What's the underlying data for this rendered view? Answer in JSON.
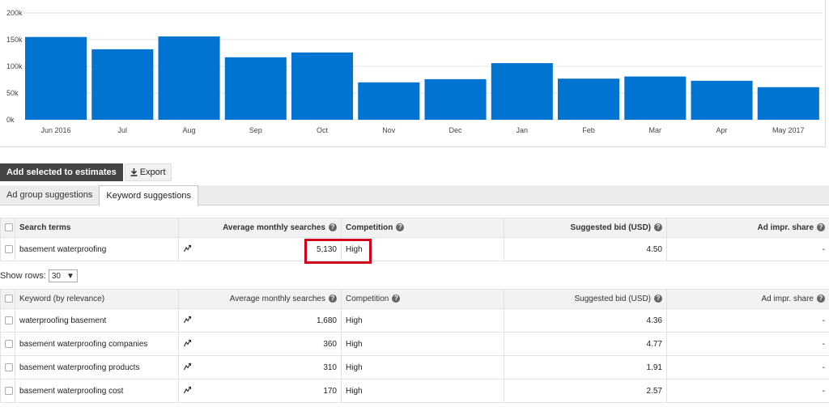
{
  "chart_data": {
    "type": "bar",
    "categories": [
      "Jun 2016",
      "Jul",
      "Aug",
      "Sep",
      "Oct",
      "Nov",
      "Dec",
      "Jan",
      "Feb",
      "Mar",
      "Apr",
      "May 2017"
    ],
    "values": [
      155000,
      132000,
      156000,
      117000,
      126000,
      70000,
      76000,
      106000,
      77000,
      81000,
      73000,
      61000
    ],
    "ylim": [
      0,
      200000
    ],
    "yticks": [
      "0k",
      "50k",
      "100k",
      "150k",
      "200k"
    ],
    "grid": true,
    "bar_color": "#0074d0"
  },
  "toolbar": {
    "add_label": "Add selected to estimates",
    "export_label": "Export"
  },
  "tabs": [
    {
      "label": "Ad group suggestions",
      "active": false
    },
    {
      "label": "Keyword suggestions",
      "active": true
    }
  ],
  "search_table": {
    "headers": {
      "term": "Search terms",
      "avg": "Average monthly searches",
      "competition": "Competition",
      "bid": "Suggested bid (USD)",
      "share": "Ad impr. share"
    },
    "rows": [
      {
        "term": "basement waterproofing",
        "avg": "5,130",
        "competition": "High",
        "bid": "4.50",
        "share": "-"
      }
    ]
  },
  "show_rows": {
    "label": "Show rows:",
    "value": "30"
  },
  "keyword_table": {
    "headers": {
      "term": "Keyword (by relevance)",
      "avg": "Average monthly searches",
      "competition": "Competition",
      "bid": "Suggested bid (USD)",
      "share": "Ad impr. share"
    },
    "rows": [
      {
        "term": "waterproofing basement",
        "avg": "1,680",
        "competition": "High",
        "bid": "4.36",
        "share": "-"
      },
      {
        "term": "basement waterproofing companies",
        "avg": "360",
        "competition": "High",
        "bid": "4.77",
        "share": "-"
      },
      {
        "term": "basement waterproofing products",
        "avg": "310",
        "competition": "High",
        "bid": "1.91",
        "share": "-"
      },
      {
        "term": "basement waterproofing cost",
        "avg": "170",
        "competition": "High",
        "bid": "2.57",
        "share": "-"
      }
    ]
  }
}
